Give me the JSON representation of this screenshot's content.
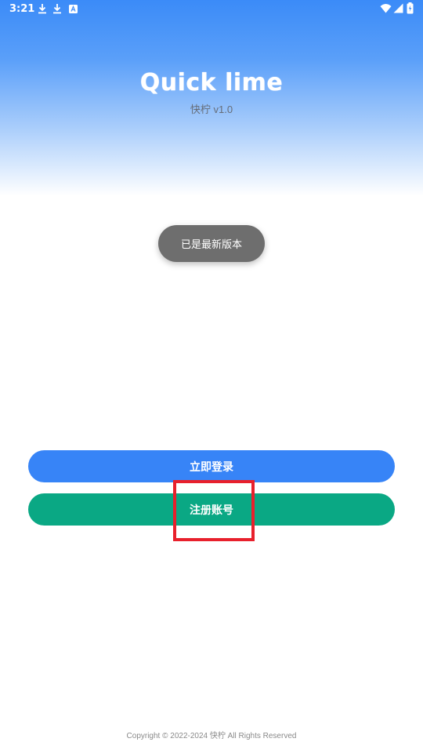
{
  "status_bar": {
    "time": "3:21",
    "icons": [
      "download-icon",
      "download-icon",
      "a-box-icon",
      "wifi-icon",
      "signal-icon",
      "battery-charging-icon"
    ]
  },
  "header": {
    "title": "Quick lime",
    "subtitle": "快柠 v1.0"
  },
  "toast": {
    "message": "已是最新版本"
  },
  "actions": {
    "login_label": "立即登录",
    "register_label": "注册账号"
  },
  "footer": {
    "copyright": "Copyright © 2022-2024 快柠 All Rights Reserved"
  },
  "colors": {
    "primary_blue": "#3784f7",
    "green": "#0aa884",
    "toast_bg": "#6e6e6e",
    "highlight": "#e8202c"
  }
}
